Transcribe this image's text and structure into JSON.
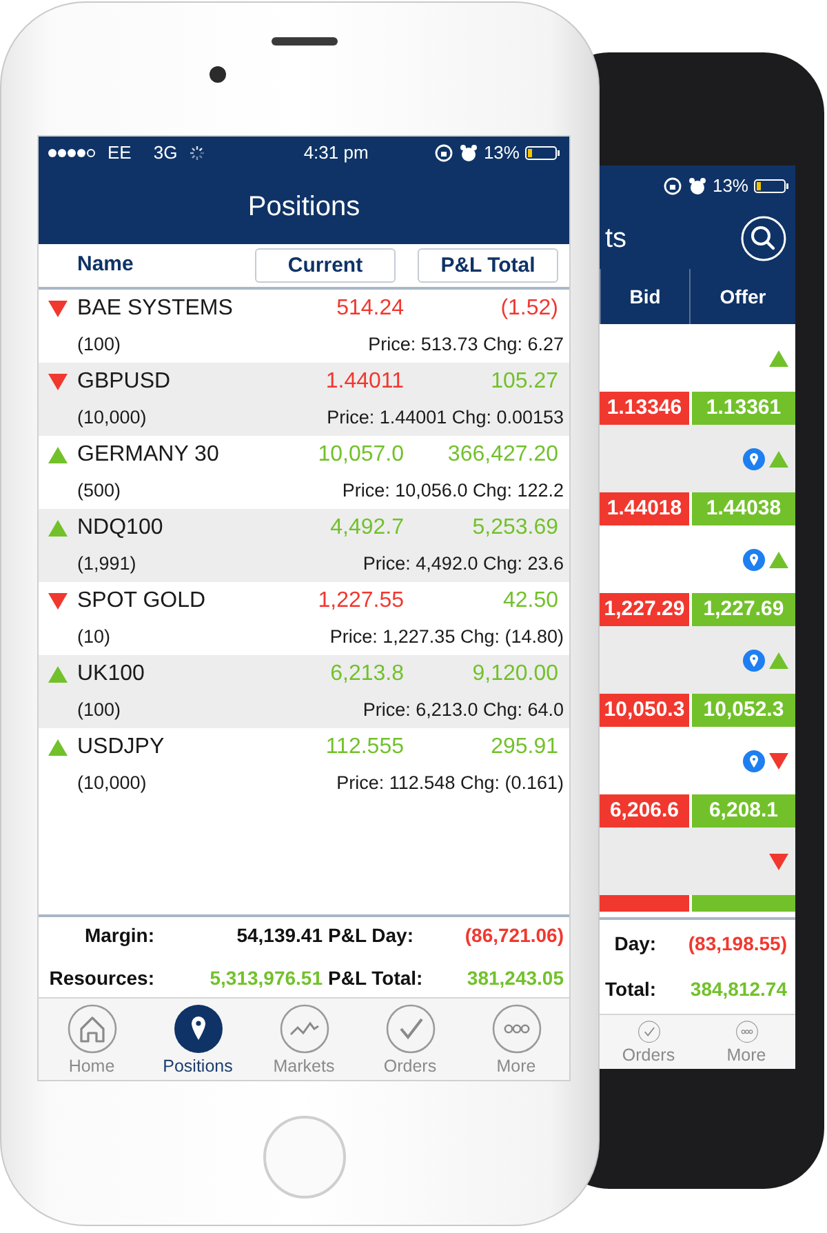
{
  "front_phone": {
    "status_bar": {
      "carrier": "EE",
      "network": "3G",
      "time": "4:31 pm",
      "battery": "13%"
    },
    "title": "Positions",
    "columns": [
      {
        "label": "Name"
      },
      {
        "label": "Current"
      },
      {
        "label": "P&L Total"
      }
    ],
    "positions": [
      {
        "name": "BAE SYSTEMS",
        "quantity": "(100)",
        "rising": false,
        "current": "514.24",
        "pl": "(1.52)",
        "loss": true,
        "detail": "Price: 513.73 Chg: 6.27"
      },
      {
        "name": "GBPUSD",
        "quantity": "(10,000)",
        "rising": false,
        "current": "1.44011",
        "pl": "105.27",
        "loss": false,
        "detail": "Price: 1.44001 Chg: 0.00153"
      },
      {
        "name": "GERMANY 30",
        "quantity": "(500)",
        "rising": true,
        "current": "10,057.0",
        "pl": "366,427.20",
        "loss": false,
        "detail": "Price: 10,056.0 Chg: 122.2"
      },
      {
        "name": "NDQ100",
        "quantity": "(1,991)",
        "rising": true,
        "current": "4,492.7",
        "pl": "5,253.69",
        "loss": false,
        "detail": "Price: 4,492.0 Chg: 23.6"
      },
      {
        "name": "SPOT GOLD",
        "quantity": "(10)",
        "rising": false,
        "current": "1,227.55",
        "pl": "42.50",
        "loss": false,
        "detail": "Price: 1,227.35 Chg: (14.80)"
      },
      {
        "name": "UK100",
        "quantity": "(100)",
        "rising": true,
        "current": "6,213.8",
        "pl": "9,120.00",
        "loss": false,
        "detail": "Price: 6,213.0 Chg: 64.0"
      },
      {
        "name": "USDJPY",
        "quantity": "(10,000)",
        "rising": true,
        "current": "112.555",
        "pl": "295.91",
        "loss": false,
        "detail": "Price: 112.548 Chg: (0.161)"
      }
    ],
    "summary": [
      {
        "label": "Margin:",
        "value": "54,139.41",
        "color": "#111111"
      },
      {
        "label": "P&L Day:",
        "value": "(86,721.06)",
        "color": "#f0382f"
      },
      {
        "label": "Resources:",
        "value": "5,313,976.51",
        "color": "#72c12b"
      },
      {
        "label": "P&L Total:",
        "value": "381,243.05",
        "color": "#72c12b"
      }
    ],
    "tabs": [
      {
        "label": "Home",
        "selected": false
      },
      {
        "label": "Positions",
        "selected": true
      },
      {
        "label": "Markets",
        "selected": false
      },
      {
        "label": "Orders",
        "selected": false
      },
      {
        "label": "More",
        "selected": false
      }
    ]
  },
  "back_phone": {
    "status_bar": {
      "battery": "13%"
    },
    "title": "ts",
    "columns": [
      {
        "label": "Bid"
      },
      {
        "label": "Offer"
      }
    ],
    "markets": [
      {
        "rising": true,
        "pinned": false,
        "bid": "1.13346",
        "offer": "1.13361"
      },
      {
        "rising": true,
        "pinned": true,
        "bid": "1.44018",
        "offer": "1.44038"
      },
      {
        "rising": true,
        "pinned": true,
        "bid": "1,227.29",
        "offer": "1,227.69"
      },
      {
        "rising": true,
        "pinned": true,
        "bid": "10,050.3",
        "offer": "10,052.3"
      },
      {
        "rising": false,
        "pinned": true,
        "bid": "6,206.6",
        "offer": "6,208.1"
      },
      {
        "rising": false,
        "pinned": false
      }
    ],
    "summary": [
      {
        "label": "Day:",
        "value": "(83,198.55)",
        "color": "#f0382f"
      },
      {
        "label": "Total:",
        "value": "384,812.74",
        "color": "#72c12b"
      }
    ],
    "tabs": [
      {
        "label": "Orders",
        "selected": false
      },
      {
        "label": "More",
        "selected": false
      }
    ]
  }
}
